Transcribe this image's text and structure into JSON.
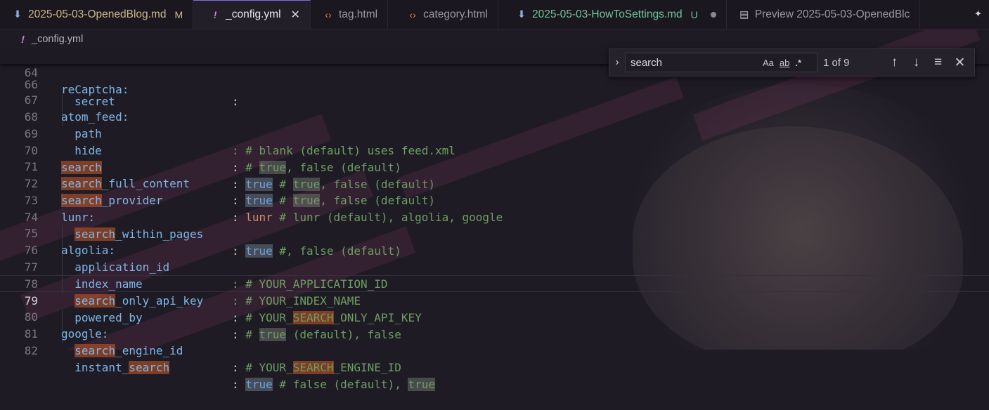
{
  "tabs": [
    {
      "label": "2025-05-03-OpenedBlog.md",
      "status": "M",
      "icon": "markdown-download-icon",
      "color": "#c9b98a"
    },
    {
      "label": "_config.yml",
      "status": "",
      "icon": "yaml-icon",
      "close": "✕",
      "active": true
    },
    {
      "label": "tag.html",
      "icon": "html-icon"
    },
    {
      "label": "category.html",
      "icon": "html-icon"
    },
    {
      "label": "2025-05-03-HowToSettings.md",
      "status": "U",
      "icon": "markdown-download-icon",
      "color": "#72c59a"
    },
    {
      "label": "Preview 2025-05-03-OpenedBlc",
      "icon": "preview-icon"
    }
  ],
  "breadcrumb": {
    "file": "_config.yml"
  },
  "sticky_line": {
    "num": "64",
    "text": "reCaptcha:"
  },
  "lines": [
    {
      "num": "66",
      "key": "secret",
      "rest": ":"
    },
    {
      "num": "67",
      "key": "atom_feed:"
    },
    {
      "num": "68",
      "key": "  path",
      "rest": ": # blank (default) uses feed.xml"
    },
    {
      "num": "69",
      "key": "  hide",
      "rest": ": # true, false (default)"
    },
    {
      "num": "70",
      "key": "search",
      "rest": ": true # true, false (default)"
    },
    {
      "num": "71",
      "key": "search_full_content",
      "rest": ": true # true, false (default)"
    },
    {
      "num": "72",
      "key": "search_provider",
      "rest": ": lunr # lunr (default), algolia, google"
    },
    {
      "num": "73",
      "key": "lunr:"
    },
    {
      "num": "74",
      "key": "  search_within_pages",
      "rest": ": true #, false (default)"
    },
    {
      "num": "75",
      "key": "algolia:"
    },
    {
      "num": "76",
      "key": "  application_id",
      "rest": ": # YOUR_APPLICATION_ID"
    },
    {
      "num": "77",
      "key": "  index_name",
      "rest": ": # YOUR_INDEX_NAME"
    },
    {
      "num": "78",
      "key": "  search_only_api_key",
      "rest": ": # YOUR_SEARCH_ONLY_API_KEY"
    },
    {
      "num": "79",
      "key": "  powered_by",
      "rest": ": # true (default), false"
    },
    {
      "num": "80",
      "key": "google:"
    },
    {
      "num": "81",
      "key": "  search_engine_id",
      "rest": ": # YOUR_SEARCH_ENGINE_ID"
    },
    {
      "num": "82",
      "key": "  instant_search",
      "rest": ": true # false (default), true"
    }
  ],
  "find": {
    "query": "search",
    "match_case": "Aa",
    "whole_word": "ab",
    "regex": ".*",
    "count": "1 of 9"
  },
  "icons": {
    "toggle": "chevron-right-icon",
    "prev": "arrow-up-icon",
    "next": "arrow-down-icon",
    "selection": "find-in-selection-icon",
    "close": "close-icon",
    "sparkle": "sparkle-icon"
  },
  "colors": {
    "accent": "#7a6fe0",
    "match_highlight": "#cc5b27"
  }
}
